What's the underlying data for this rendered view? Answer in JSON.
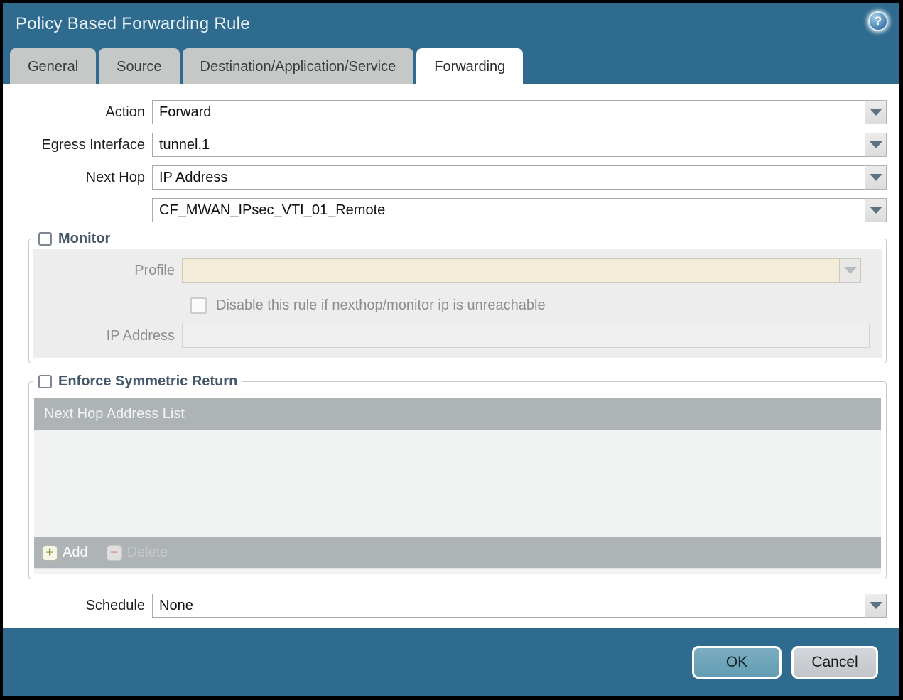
{
  "window": {
    "title": "Policy Based Forwarding Rule",
    "help_glyph": "?"
  },
  "tabs": [
    {
      "label": "General",
      "active": false
    },
    {
      "label": "Source",
      "active": false
    },
    {
      "label": "Destination/Application/Service",
      "active": false
    },
    {
      "label": "Forwarding",
      "active": true
    }
  ],
  "form": {
    "action": {
      "label": "Action",
      "value": "Forward"
    },
    "egress_interface": {
      "label": "Egress Interface",
      "value": "tunnel.1"
    },
    "next_hop": {
      "label": "Next Hop",
      "value": "IP Address"
    },
    "next_hop_address": {
      "value": "CF_MWAN_IPsec_VTI_01_Remote"
    },
    "schedule": {
      "label": "Schedule",
      "value": "None"
    }
  },
  "monitor": {
    "legend": "Monitor",
    "checked": false,
    "profile": {
      "label": "Profile",
      "value": ""
    },
    "disable_rule_label": "Disable this rule if nexthop/monitor ip is unreachable",
    "disable_rule_checked": false,
    "ip_address": {
      "label": "IP Address",
      "value": ""
    }
  },
  "enforce_symmetric_return": {
    "legend": "Enforce Symmetric Return",
    "checked": false,
    "table": {
      "header": "Next Hop Address List",
      "rows": []
    },
    "add_label": "Add",
    "add_glyph": "+",
    "delete_label": "Delete",
    "delete_glyph": "−"
  },
  "footer": {
    "ok_label": "OK",
    "cancel_label": "Cancel"
  },
  "colors": {
    "titlebar_teal": "#2f6b8f",
    "active_tab": "#ffffff",
    "inactive_tab": "#c6c7c7",
    "fieldset_legend_text": "#44576b",
    "disabled_field_tan": "#f3ecd8",
    "table_gray": "#aeb3b6",
    "ok_button": "#6ea6bb",
    "cancel_button": "#c9cdd1",
    "add_plus_green": "#7e9a2c",
    "delete_minus_red": "#c77f89"
  }
}
